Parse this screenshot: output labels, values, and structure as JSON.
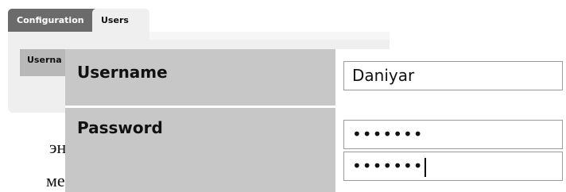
{
  "tabs": [
    {
      "label": "Configuration"
    },
    {
      "label": "Users"
    }
  ],
  "table": {
    "column_header": "Userna"
  },
  "form": {
    "username_label": "Username",
    "username_value": "Daniyar",
    "password_label": "Password",
    "password_value": "•••••••",
    "confirm_password_value": "•••••••"
  },
  "background_text": {
    "line1": "эне",
    "line2": "мен"
  }
}
